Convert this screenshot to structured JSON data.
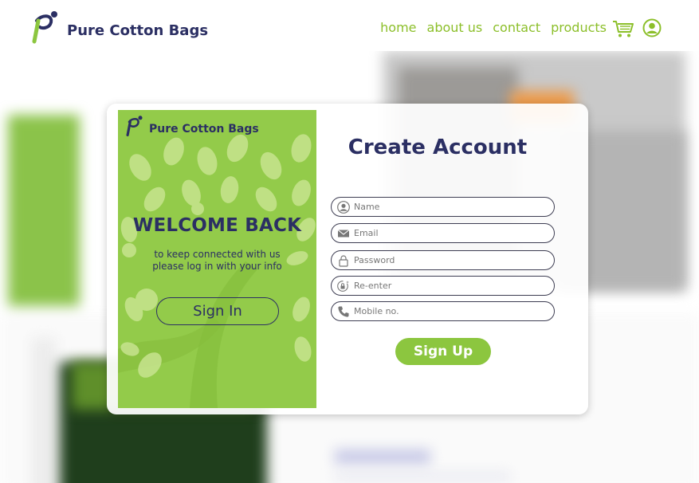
{
  "header": {
    "brand_name": "Pure Cotton Bags",
    "nav": [
      {
        "label": "home"
      },
      {
        "label": "about us"
      },
      {
        "label": "contact"
      },
      {
        "label": "products"
      }
    ],
    "icons": [
      "cart-icon",
      "user-icon"
    ]
  },
  "welcome_panel": {
    "brand_name": "Pure Cotton Bags",
    "title": "WELCOME BACK",
    "subtitle_line1": "to keep connected with us",
    "subtitle_line2": "please log in with your info",
    "signin_label": "Sign In"
  },
  "signup_form": {
    "title": "Create Account",
    "fields": [
      {
        "placeholder": "Name",
        "icon": "user-circle-icon"
      },
      {
        "placeholder": "Email",
        "icon": "envelope-icon"
      },
      {
        "placeholder": "Password",
        "icon": "lock-icon"
      },
      {
        "placeholder": "Re-enter",
        "icon": "lock-refresh-icon"
      },
      {
        "placeholder": "Mobile no.",
        "icon": "phone-icon"
      }
    ],
    "submit_label": "Sign Up"
  },
  "colors": {
    "brand_navy": "#2b2f63",
    "accent_green": "#8cc63f",
    "nav_green": "#8cbf2a",
    "panel_green": "#93cb4a"
  }
}
